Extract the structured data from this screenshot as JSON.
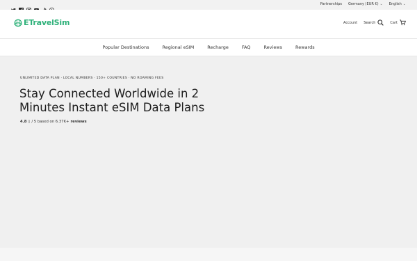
{
  "topbar": {
    "social": [
      "twitter-icon",
      "facebook-icon",
      "instagram-icon",
      "youtube-icon",
      "tiktok-icon",
      "pinterest-icon"
    ],
    "partnerships": "Partnerships",
    "country": "Germany (EUR €)",
    "language": "English"
  },
  "header": {
    "logo": "ETravelSim",
    "account": "Account",
    "search": "Search",
    "cart": "Cart"
  },
  "nav": {
    "items": [
      "Popular Destinations",
      "Regional eSIM",
      "Recharge",
      "FAQ",
      "Reviews",
      "Rewards"
    ]
  },
  "hero": {
    "tagline": "UNLIMITED DATA PLAN · LOCAL NUMBERS · 150+ COUNTRIES · NO ROAMING FEES",
    "title": "Stay Connected Worldwide in 2 Minutes Instant eSIM Data Plans",
    "rating_score": "4.8",
    "rating_glyph": "▯",
    "rating_rest": "/ 5 based on 6.37K+",
    "rating_reviews": "reviews"
  },
  "colors": {
    "brand": "#2fb17a",
    "hero_bg": "#f0f0f0"
  }
}
